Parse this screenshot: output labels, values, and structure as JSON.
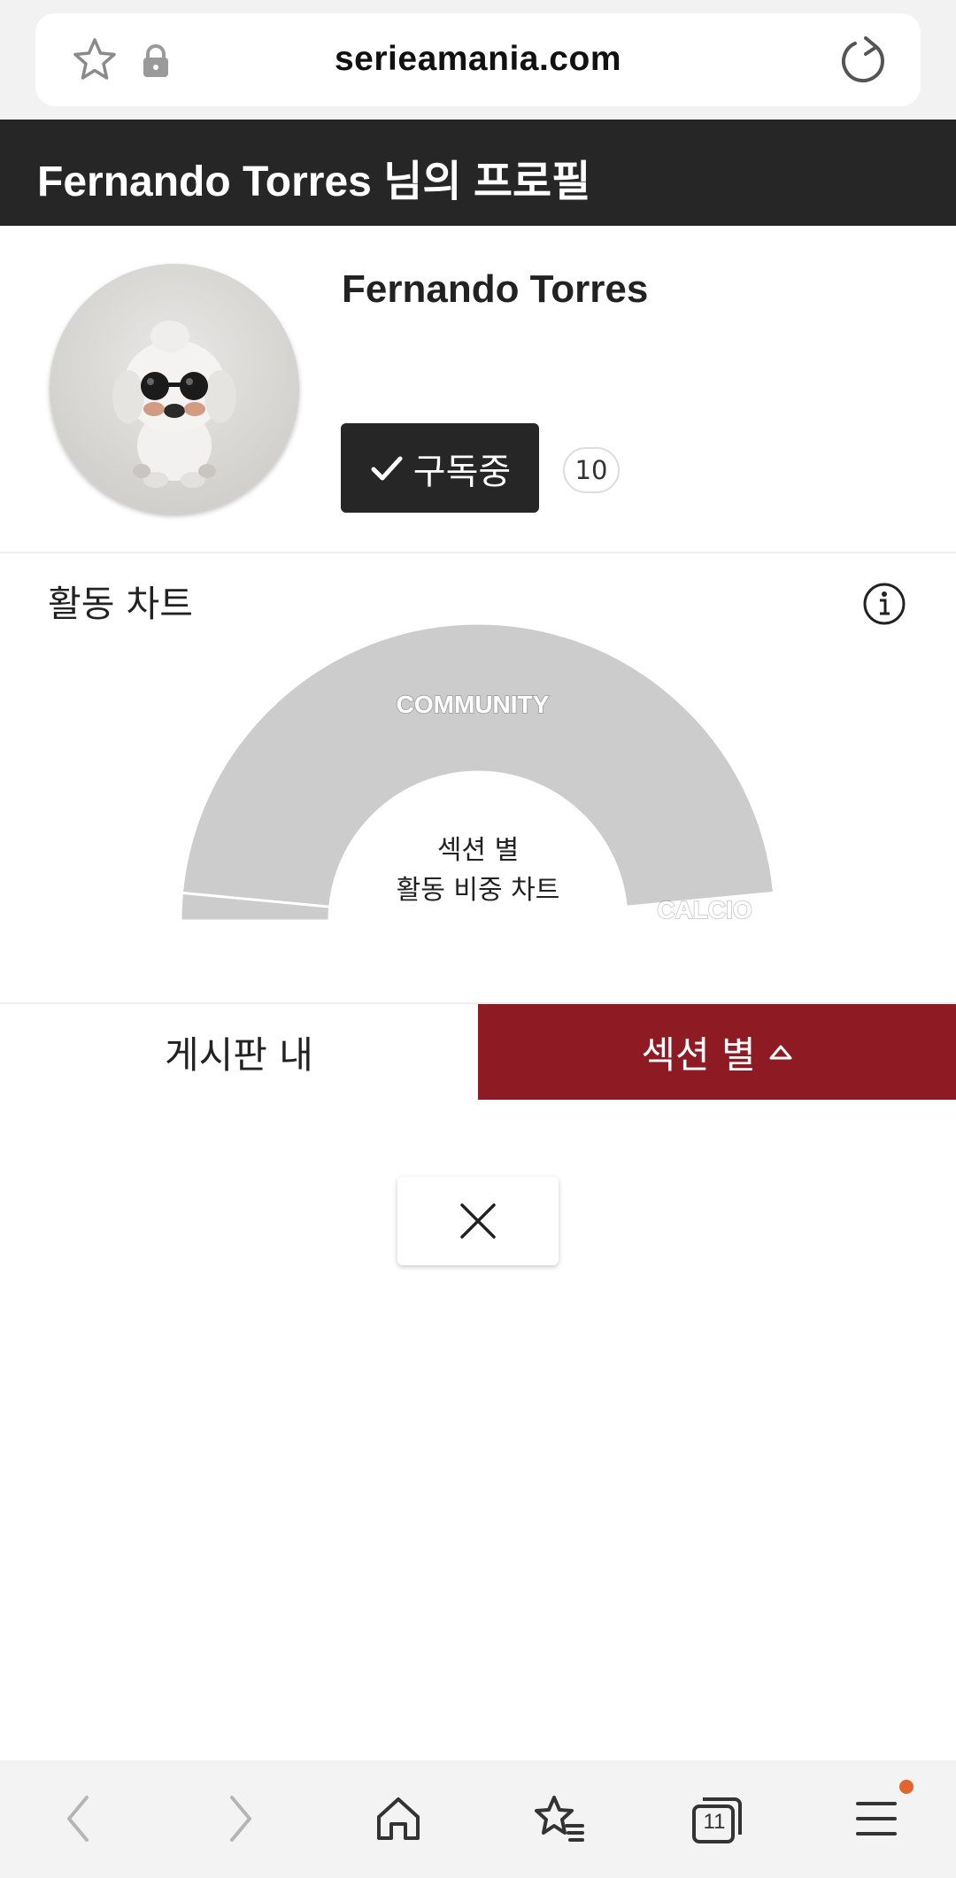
{
  "browser": {
    "domain": "serieamania.com",
    "icons": [
      "star-icon",
      "lock-icon",
      "reload-icon"
    ]
  },
  "header": {
    "title": "Fernando Torres 님의 프로필"
  },
  "profile": {
    "name": "Fernando Torres",
    "subscribe_label": "구독중",
    "subscriber_count": "10"
  },
  "activity_chart": {
    "title": "활동 차트",
    "center_line1": "섹션 별",
    "center_line2": "활동 비중 차트",
    "chart_data": {
      "type": "pie",
      "title": "",
      "categories": [
        "COMMUNITY",
        "CALCIO"
      ],
      "values": [
        97,
        3
      ],
      "colors": [
        "#cccccc",
        "#cccccc"
      ]
    }
  },
  "tabs": {
    "left_label": "게시판 내",
    "right_label": "섹션 별",
    "active": "right",
    "active_color": "#8e1b24"
  },
  "bottom_nav": {
    "tabs_count": "11",
    "icons": [
      "back-icon",
      "forward-icon",
      "home-icon",
      "bookmarks-icon",
      "tabs-icon",
      "menu-icon"
    ]
  }
}
